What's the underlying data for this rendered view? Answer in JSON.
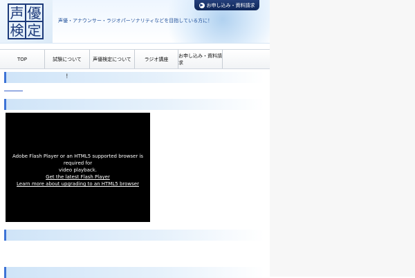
{
  "header": {
    "logo_chars": [
      "声",
      "優",
      "検",
      "定"
    ],
    "tagline": "声優・アナウンサー・ラジオパーソナリティなどを目指している方に！",
    "apply_button": "お申し込み・資料請求"
  },
  "nav": {
    "items": [
      {
        "label": "TOP"
      },
      {
        "label": "試験について"
      },
      {
        "label": "声優検定について"
      },
      {
        "label": "ラジオ講座"
      },
      {
        "label": "お申し込み・資料請求"
      }
    ]
  },
  "sections": {
    "first_heading": "!"
  },
  "video": {
    "message_line1": "Adobe Flash Player or an HTML5 supported browser is required for",
    "message_line2": "video playback.",
    "link_flash": "Get the latest Flash Player",
    "link_html5": "Learn more about upgrading to an HTML5 browser"
  },
  "colors": {
    "accent": "#3d73d6",
    "logo_blue": "#1c3a7a",
    "apply_button_bg": "#0f2658"
  }
}
